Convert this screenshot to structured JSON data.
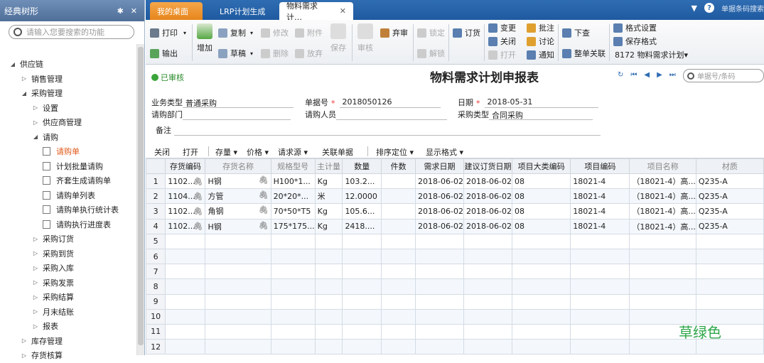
{
  "left_panel": {
    "title": "经典树形",
    "pin": "✱",
    "close": "✕",
    "search_placeholder": "请输入您要搜索的功能",
    "tree": [
      {
        "label": "供应链",
        "level": 0,
        "type": "open"
      },
      {
        "label": "销售管理",
        "level": 1,
        "type": "closed"
      },
      {
        "label": "采购管理",
        "level": 1,
        "type": "open"
      },
      {
        "label": "设置",
        "level": 2,
        "type": "closed"
      },
      {
        "label": "供应商管理",
        "level": 2,
        "type": "closed"
      },
      {
        "label": "请购",
        "level": 2,
        "type": "open"
      },
      {
        "label": "请购单",
        "level": 3,
        "type": "doc",
        "selected": true
      },
      {
        "label": "计划批量请购",
        "level": 3,
        "type": "doc"
      },
      {
        "label": "齐套生成请购单",
        "level": 3,
        "type": "doc"
      },
      {
        "label": "请购单列表",
        "level": 3,
        "type": "doc"
      },
      {
        "label": "请购单执行统计表",
        "level": 3,
        "type": "doc"
      },
      {
        "label": "请购执行进度表",
        "level": 3,
        "type": "doc"
      },
      {
        "label": "采购订货",
        "level": 2,
        "type": "closed"
      },
      {
        "label": "采购到货",
        "level": 2,
        "type": "closed"
      },
      {
        "label": "采购入库",
        "level": 2,
        "type": "closed"
      },
      {
        "label": "采购发票",
        "level": 2,
        "type": "closed"
      },
      {
        "label": "采购结算",
        "level": 2,
        "type": "closed"
      },
      {
        "label": "月末结账",
        "level": 2,
        "type": "closed"
      },
      {
        "label": "报表",
        "level": 2,
        "type": "closed"
      },
      {
        "label": "库存管理",
        "level": 1,
        "type": "closed"
      },
      {
        "label": "存货核算",
        "level": 1,
        "type": "closed"
      }
    ]
  },
  "tabs": [
    {
      "label": "我的桌面"
    },
    {
      "label": "LRP计划生成"
    },
    {
      "label": "物料需求计…"
    }
  ],
  "tab_close": "✕",
  "top_controls": {
    "dropdown": "▼",
    "help": "?",
    "search_placeholder": "单据条码搜索"
  },
  "toolbar": {
    "print": "打印",
    "output": "输出",
    "add": "增加",
    "copy": "复制",
    "draft": "草稿",
    "modify": "修改",
    "delete": "删除",
    "attach": "附件",
    "abandon": "放弃",
    "save": "保存",
    "audit": "审核",
    "reject": "弃审",
    "lock": "锁定",
    "unlock": "解锁",
    "order": "订货",
    "change": "变更",
    "close": "关闭",
    "open": "打开",
    "approve": "批注",
    "discuss": "讨论",
    "notify": "通知",
    "query": "下查",
    "whole_link": "整单关联",
    "format_set": "格式设置",
    "save_format": "保存格式",
    "template": "8172 物料需求计划▾"
  },
  "bill": {
    "status": "已审核",
    "title": "物料需求计划申报表",
    "nav_icons": [
      "↻",
      "⏮",
      "◀",
      "▶",
      "⏭"
    ],
    "search_placeholder": "单据号/条码",
    "fields": {
      "biz_type_label": "业务类型",
      "biz_type_value": "普通采购",
      "bill_no_label": "单据号",
      "bill_no_value": "2018050126",
      "date_label": "日期",
      "date_value": "2018-05-31",
      "dept_label": "请购部门",
      "dept_value": "",
      "person_label": "请购人员",
      "person_value": "",
      "purchase_type_label": "采购类型",
      "purchase_type_value": "合同采购",
      "remark_label": "备注",
      "remark_value": ""
    },
    "required_mark": "*"
  },
  "grid_toolbar": {
    "close": "关闭",
    "open": "打开",
    "stock": "存量",
    "price": "价格",
    "source": "请求源",
    "linked": "关联单据",
    "sort": "排序定位",
    "display": "显示格式",
    "caret": "▾"
  },
  "grid": {
    "columns": [
      "",
      "存货编码",
      "存货名称",
      "规格型号",
      "主计量",
      "数量",
      "件数",
      "需求日期",
      "建议订货日期",
      "项目大类编码",
      "项目编码",
      "项目名称",
      "材质"
    ],
    "rows": [
      [
        "1",
        "1102...",
        "H钢",
        "H100*1...",
        "Kg",
        "103.2...",
        "",
        "2018-06-02",
        "2018-06-02",
        "08",
        "18021-4",
        "（18021-4）高...",
        "Q235-A"
      ],
      [
        "2",
        "1104...",
        "方管",
        "20*20*...",
        "米",
        "12.0000",
        "",
        "2018-06-02",
        "2018-06-02",
        "08",
        "18021-4",
        "（18021-4）高...",
        "Q235-A"
      ],
      [
        "3",
        "1102...",
        "角钢",
        "70*50*T5",
        "Kg",
        "105.6...",
        "",
        "2018-06-02",
        "2018-06-02",
        "08",
        "18021-4",
        "（18021-4）高...",
        "Q235-A"
      ],
      [
        "4",
        "1102...",
        "H钢",
        "175*175...",
        "Kg",
        "2418....",
        "",
        "2018-06-02",
        "2018-06-02",
        "08",
        "18021-4",
        "（18021-4）高...",
        "Q235-A"
      ],
      [
        "5",
        "",
        "",
        "",
        "",
        "",
        "",
        "",
        "",
        "",
        "",
        "",
        ""
      ],
      [
        "6",
        "",
        "",
        "",
        "",
        "",
        "",
        "",
        "",
        "",
        "",
        "",
        ""
      ],
      [
        "7",
        "",
        "",
        "",
        "",
        "",
        "",
        "",
        "",
        "",
        "",
        "",
        ""
      ],
      [
        "8",
        "",
        "",
        "",
        "",
        "",
        "",
        "",
        "",
        "",
        "",
        "",
        ""
      ],
      [
        "9",
        "",
        "",
        "",
        "",
        "",
        "",
        "",
        "",
        "",
        "",
        "",
        ""
      ],
      [
        "10",
        "",
        "",
        "",
        "",
        "",
        "",
        "",
        "",
        "",
        "",
        "",
        ""
      ],
      [
        "11",
        "",
        "",
        "",
        "",
        "",
        "",
        "",
        "",
        "",
        "",
        "",
        ""
      ],
      [
        "12",
        "",
        "",
        "",
        "",
        "",
        "",
        "",
        "",
        "",
        "",
        "",
        ""
      ]
    ],
    "attachment_glyph": "🖇"
  },
  "watermark": "草绿色",
  "colors": {
    "accent": "#2f6db3",
    "tab_orange": "#f19a33",
    "selected": "#e05a1a",
    "status_green": "#2a8a2a"
  }
}
